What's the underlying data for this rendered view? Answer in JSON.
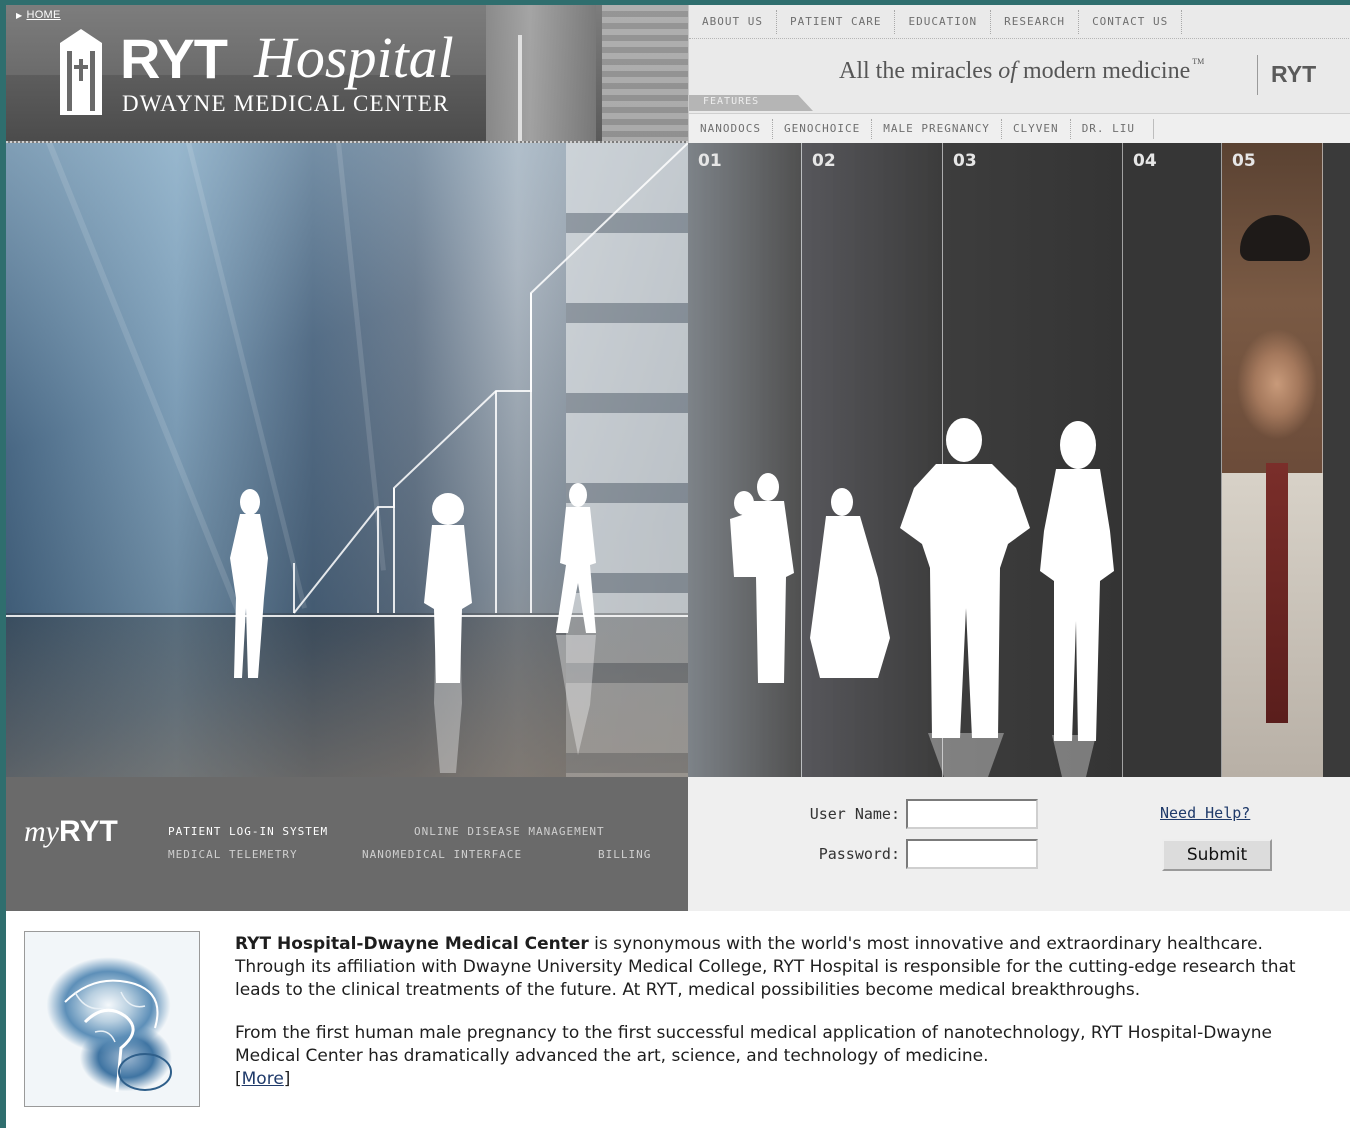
{
  "header": {
    "home_link": "HOME",
    "logo_ryt": "RYT",
    "logo_hospital": "Hospital",
    "logo_subtitle": "DWAYNE MEDICAL CENTER",
    "top_nav": [
      "ABOUT US",
      "PATIENT CARE",
      "EDUCATION",
      "RESEARCH",
      "CONTACT US"
    ],
    "tagline_part1": "All the miracles",
    "tagline_of": "of",
    "tagline_part2": "modern medicine",
    "tagline_tm": "TM",
    "tagline_brand": "RYT",
    "features_label": "FEATURES",
    "feature_nav": [
      "NANODOCS",
      "GENOCHOICE",
      "MALE PREGNANCY",
      "CLYVEN",
      "DR. LIU"
    ]
  },
  "hero": {
    "columns": [
      "01",
      "02",
      "03",
      "04",
      "05"
    ]
  },
  "portal": {
    "logo_my": "my",
    "logo_ryt": "RYT",
    "links": [
      {
        "label": "PATIENT LOG-IN SYSTEM",
        "color": "#ffffff"
      },
      {
        "label": "ONLINE DISEASE MANAGEMENT",
        "color": "#cfcfcf"
      },
      {
        "label": "MEDICAL TELEMETRY",
        "color": "#cfcfcf"
      },
      {
        "label": "NANOMEDICAL INTERFACE",
        "color": "#cfcfcf"
      },
      {
        "label": "BILLING",
        "color": "#cfcfcf"
      }
    ]
  },
  "login": {
    "username_label": "User Name:",
    "password_label": "Password:",
    "username_value": "",
    "password_value": "",
    "help_link": "Need Help?",
    "submit_label": "Submit"
  },
  "content": {
    "p1_bold": "RYT Hospital-Dwayne Medical Center",
    "p1_rest": " is synonymous with the world's most innovative and extraordinary healthcare. Through its affiliation with Dwayne University Medical College, RYT Hospital is responsible for the cutting-edge research that leads to the clinical treatments of the future. At RYT, medical possibilities become medical breakthroughs.",
    "p2": "From the first human male pregnancy to the first successful medical application of nanotechnology, RYT Hospital-Dwayne Medical Center has dramatically advanced the art, science, and technology of medicine.",
    "more_open": "[",
    "more_link": "More",
    "more_close": "]"
  },
  "colors": {
    "page_border": "#2f6e6e",
    "link": "#1f3a6a",
    "portal_band": "#6a6a6a",
    "login_band": "#efefef"
  }
}
